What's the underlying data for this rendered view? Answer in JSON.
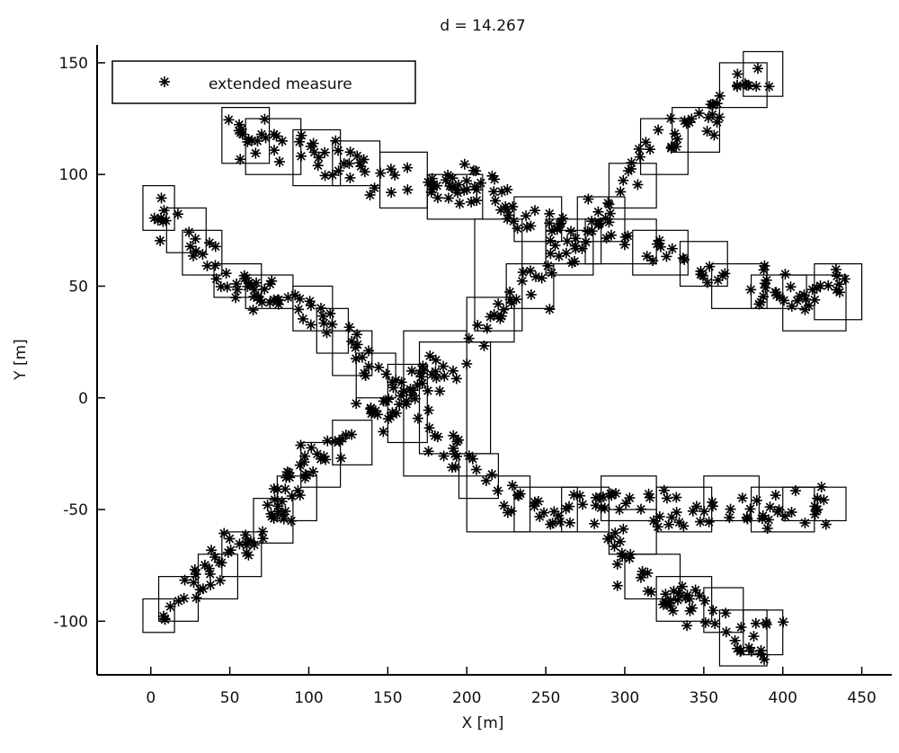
{
  "chart_data": {
    "type": "scatter",
    "title": "d = 14.267",
    "xlabel": "X [m]",
    "ylabel": "Y [m]",
    "xlim": [
      -34,
      469
    ],
    "ylim": [
      -124,
      158
    ],
    "xticks": [
      0,
      50,
      100,
      150,
      200,
      250,
      300,
      350,
      400,
      450
    ],
    "yticks": [
      -100,
      -50,
      0,
      50,
      100,
      150
    ],
    "grid": false,
    "legend": {
      "position": "top-left",
      "entries": [
        {
          "label": "extended measure",
          "marker": "*"
        }
      ]
    },
    "series": [
      {
        "name": "extended measure",
        "marker": "*",
        "color": "#000000",
        "tracks": [
          {
            "waypoints": [
              [
                0,
                85
              ],
              [
                20,
                75
              ],
              [
                45,
                55
              ],
              [
                80,
                45
              ],
              [
                110,
                40
              ],
              [
                130,
                20
              ],
              [
                150,
                0
              ],
              [
                175,
                -10
              ],
              [
                200,
                -30
              ],
              [
                230,
                -45
              ],
              [
                260,
                -52
              ],
              [
                300,
                -45
              ],
              [
                340,
                -50
              ],
              [
                380,
                -50
              ],
              [
                430,
                -50
              ]
            ]
          },
          {
            "waypoints": [
              [
                0,
                -100
              ],
              [
                20,
                -90
              ],
              [
                50,
                -70
              ],
              [
                80,
                -50
              ],
              [
                100,
                -30
              ],
              [
                125,
                -15
              ],
              [
                150,
                -5
              ],
              [
                175,
                10
              ],
              [
                200,
                20
              ],
              [
                215,
                35
              ],
              [
                240,
                50
              ],
              [
                260,
                65
              ],
              [
                290,
                85
              ],
              [
                310,
                105
              ],
              [
                340,
                120
              ],
              [
                375,
                140
              ],
              [
                390,
                145
              ]
            ]
          },
          {
            "waypoints": [
              [
                50,
                120
              ],
              [
                75,
                112
              ],
              [
                100,
                110
              ],
              [
                130,
                105
              ],
              [
                150,
                95
              ],
              [
                175,
                95
              ],
              [
                200,
                95
              ],
              [
                225,
                85
              ],
              [
                250,
                78
              ],
              [
                270,
                70
              ],
              [
                300,
                68
              ],
              [
                330,
                62
              ],
              [
                360,
                55
              ],
              [
                390,
                50
              ],
              [
                420,
                45
              ],
              [
                440,
                50
              ]
            ]
          },
          {
            "waypoints": [
              [
                290,
                -55
              ],
              [
                305,
                -80
              ],
              [
                330,
                -90
              ],
              [
                355,
                -95
              ],
              [
                370,
                -110
              ],
              [
                385,
                -110
              ],
              [
                390,
                -100
              ]
            ]
          }
        ],
        "points_per_track": [
          190,
          200,
          170,
          60
        ],
        "spread": 9
      }
    ],
    "gates": [
      [
        -5,
        75,
        15,
        95
      ],
      [
        10,
        65,
        35,
        85
      ],
      [
        20,
        55,
        45,
        75
      ],
      [
        40,
        45,
        70,
        60
      ],
      [
        60,
        40,
        90,
        55
      ],
      [
        90,
        30,
        115,
        50
      ],
      [
        105,
        20,
        125,
        40
      ],
      [
        115,
        10,
        140,
        30
      ],
      [
        130,
        0,
        155,
        20
      ],
      [
        150,
        -20,
        175,
        15
      ],
      [
        160,
        -35,
        200,
        30
      ],
      [
        170,
        -25,
        215,
        25
      ],
      [
        195,
        -45,
        220,
        -25
      ],
      [
        200,
        -60,
        240,
        -35
      ],
      [
        230,
        -60,
        270,
        -40
      ],
      [
        260,
        -60,
        290,
        -40
      ],
      [
        285,
        -55,
        320,
        -35
      ],
      [
        320,
        -60,
        355,
        -40
      ],
      [
        350,
        -55,
        385,
        -35
      ],
      [
        380,
        -60,
        420,
        -40
      ],
      [
        400,
        -55,
        440,
        -40
      ],
      [
        -5,
        -105,
        15,
        -90
      ],
      [
        5,
        -100,
        30,
        -80
      ],
      [
        30,
        -90,
        55,
        -70
      ],
      [
        45,
        -80,
        70,
        -60
      ],
      [
        65,
        -65,
        90,
        -45
      ],
      [
        80,
        -55,
        105,
        -35
      ],
      [
        95,
        -40,
        120,
        -20
      ],
      [
        115,
        -30,
        140,
        -10
      ],
      [
        200,
        25,
        230,
        45
      ],
      [
        225,
        40,
        255,
        60
      ],
      [
        250,
        55,
        280,
        75
      ],
      [
        270,
        70,
        300,
        90
      ],
      [
        290,
        85,
        320,
        105
      ],
      [
        310,
        100,
        340,
        125
      ],
      [
        330,
        110,
        360,
        130
      ],
      [
        360,
        130,
        390,
        150
      ],
      [
        375,
        135,
        400,
        155
      ],
      [
        45,
        105,
        75,
        130
      ],
      [
        60,
        100,
        95,
        125
      ],
      [
        90,
        95,
        120,
        120
      ],
      [
        115,
        95,
        145,
        115
      ],
      [
        145,
        85,
        175,
        110
      ],
      [
        175,
        80,
        210,
        100
      ],
      [
        205,
        30,
        235,
        80
      ],
      [
        230,
        70,
        260,
        90
      ],
      [
        250,
        60,
        285,
        80
      ],
      [
        275,
        60,
        320,
        80
      ],
      [
        305,
        55,
        340,
        75
      ],
      [
        335,
        50,
        365,
        70
      ],
      [
        355,
        40,
        390,
        60
      ],
      [
        380,
        40,
        415,
        55
      ],
      [
        400,
        30,
        440,
        55
      ],
      [
        420,
        35,
        450,
        60
      ],
      [
        290,
        -70,
        320,
        -50
      ],
      [
        300,
        -90,
        335,
        -70
      ],
      [
        320,
        -100,
        355,
        -80
      ],
      [
        350,
        -105,
        375,
        -85
      ],
      [
        360,
        -120,
        390,
        -95
      ],
      [
        375,
        -115,
        400,
        -95
      ]
    ],
    "seed": 14267
  }
}
